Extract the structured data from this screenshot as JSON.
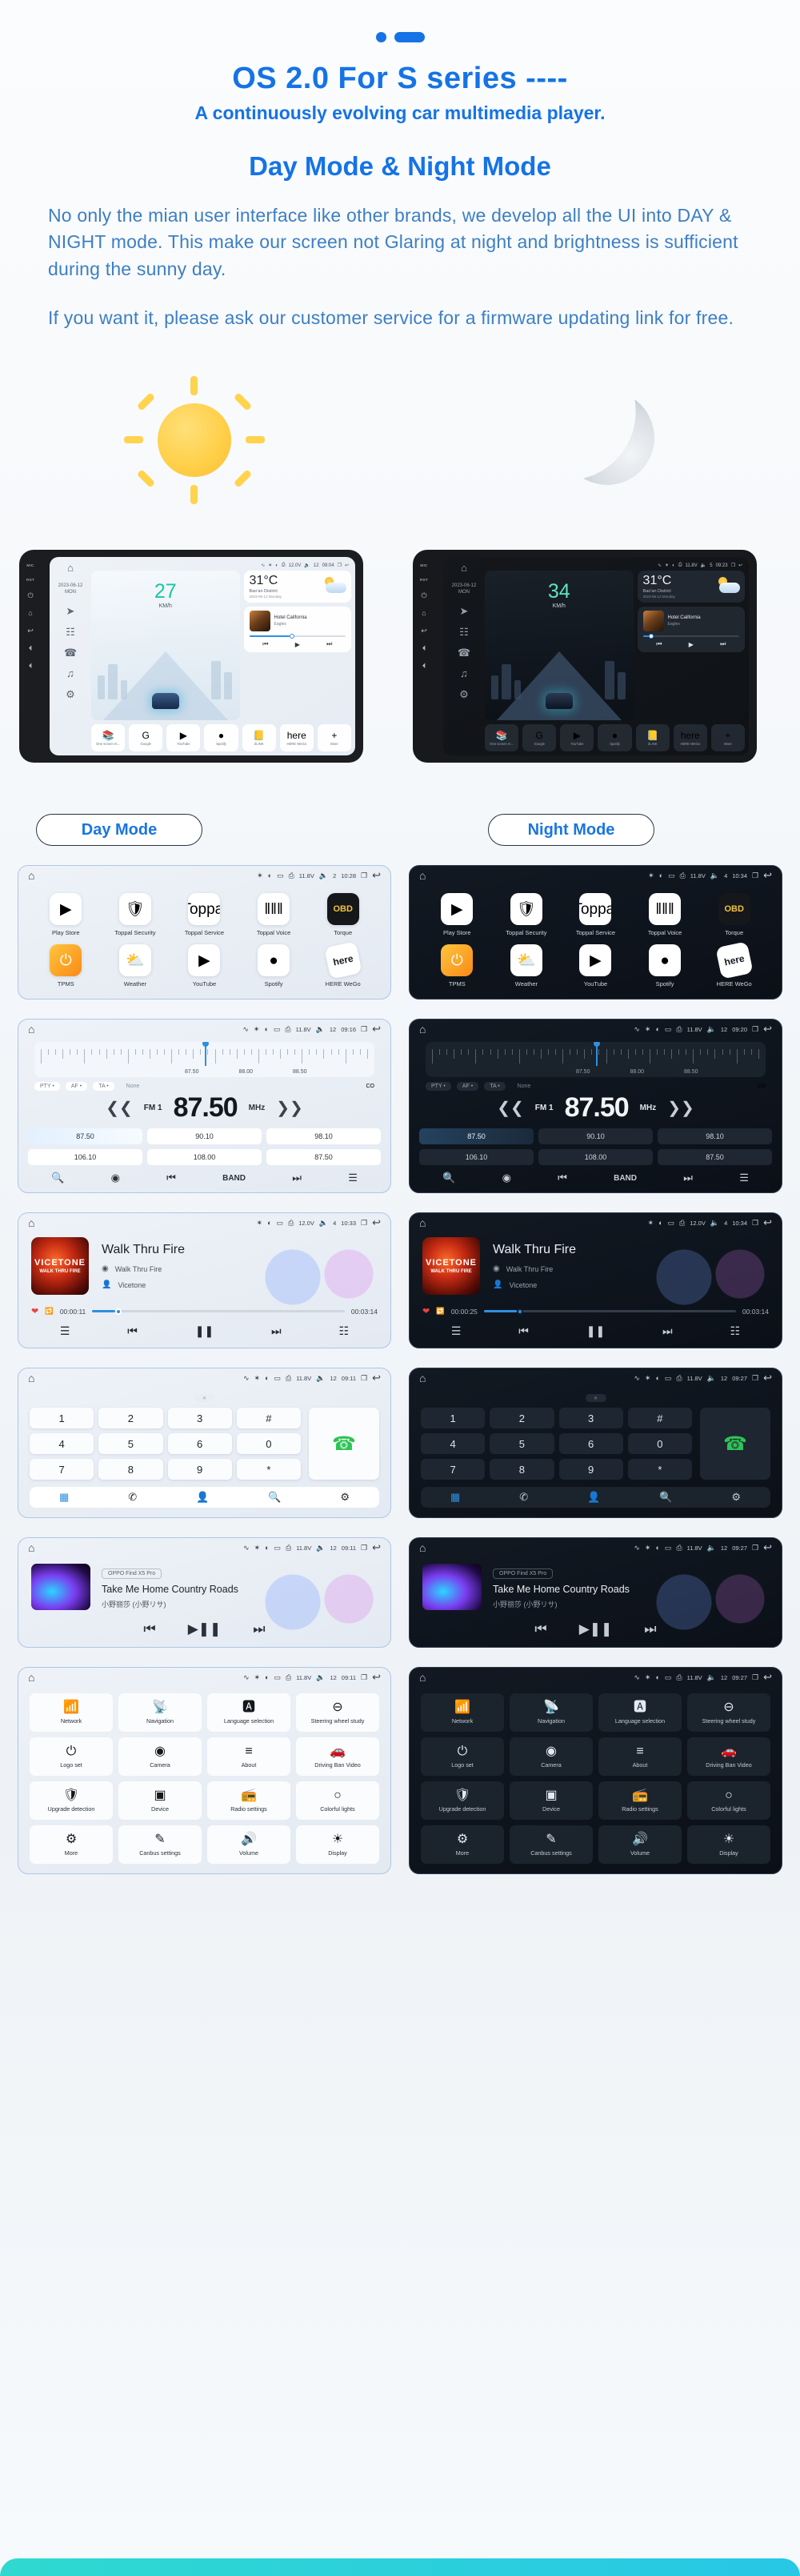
{
  "header": {
    "title": "OS 2.0 For S series ----",
    "subtitle": "A continuously evolving car multimedia player.",
    "section_title": "Day Mode & Night Mode",
    "paragraph1": "No only the mian user interface like other brands, we develop all the UI into DAY & NIGHT mode. This make our screen not Glaring at night and brightness is sufficient during the sunny day.",
    "paragraph2": "If you want it, please ask our customer service for a firmware updating link for free.",
    "accent_color": "#1573e6",
    "body_color": "#3d7fc4"
  },
  "badges": {
    "day": "Day Mode",
    "night": "Night Mode"
  },
  "head_units": {
    "day": {
      "date": "2023-06-12",
      "weekday": "MON",
      "speed": "27",
      "speed_unit": "KM/h",
      "status": {
        "voltage": "12.0V",
        "volume": "12",
        "time": "09:04"
      },
      "weather": {
        "temp": "31°C",
        "location": "Bao'an District",
        "date": "2023-06-12 Monday"
      },
      "now_playing": {
        "title": "Hotel California",
        "artist": "Eagles"
      },
      "dock": [
        {
          "name": "One screen m...",
          "glyph": "📚"
        },
        {
          "name": "Google",
          "glyph": "G"
        },
        {
          "name": "YouTube",
          "glyph": "▶"
        },
        {
          "name": "Spotify",
          "glyph": "●"
        },
        {
          "name": "ZLINK",
          "glyph": "📒"
        },
        {
          "name": "HERE WeGo",
          "glyph": "here"
        },
        {
          "name": "More",
          "glyph": "+"
        }
      ]
    },
    "night": {
      "date": "2023-06-12",
      "weekday": "MON",
      "speed": "34",
      "speed_unit": "KM/h",
      "status": {
        "voltage": "11.8V",
        "volume": "5",
        "time": "09:23"
      },
      "weather": {
        "temp": "31°C",
        "location": "Bao'an District",
        "date": "2023-06-12 Monday"
      },
      "now_playing": {
        "title": "Hotel California",
        "artist": "Eagles"
      },
      "dock": [
        {
          "name": "One screen m...",
          "glyph": "📚"
        },
        {
          "name": "Google",
          "glyph": "G"
        },
        {
          "name": "YouTube",
          "glyph": "▶"
        },
        {
          "name": "Spotify",
          "glyph": "●"
        },
        {
          "name": "ZLINK",
          "glyph": "📒"
        },
        {
          "name": "HERE WeGo",
          "glyph": "here"
        },
        {
          "name": "More",
          "glyph": "+"
        }
      ]
    }
  },
  "rows": {
    "apps": {
      "day_status": {
        "voltage": "11.8V",
        "volume": "2",
        "time": "10:28"
      },
      "night_status": {
        "voltage": "11.8V",
        "volume": "4",
        "time": "10:34"
      },
      "items": [
        {
          "label": "Play Store",
          "glyph": "▶"
        },
        {
          "label": "Toppal Security",
          "glyph": "🛡"
        },
        {
          "label": "Toppal Service",
          "glyph": "Toppal"
        },
        {
          "label": "Toppal Voice",
          "glyph": "‖‖‖"
        },
        {
          "label": "Torque",
          "glyph": "OBD"
        },
        {
          "label": "TPMS",
          "glyph": "⏻"
        },
        {
          "label": "Weather",
          "glyph": "⛅"
        },
        {
          "label": "YouTube",
          "glyph": "▶"
        },
        {
          "label": "Spotify",
          "glyph": "●"
        },
        {
          "label": "HERE WeGo",
          "glyph": "here"
        }
      ]
    },
    "radio": {
      "day_status": {
        "voltage": "11.8V",
        "volume": "12",
        "time": "09:16"
      },
      "night_status": {
        "voltage": "11.8V",
        "volume": "12",
        "time": "09:20"
      },
      "band": "FM 1",
      "frequency": "87.50",
      "unit": "MHz",
      "dial_labels": [
        "87.50",
        "88.00",
        "88.50"
      ],
      "rds": [
        "PTY",
        "AF",
        "TA"
      ],
      "rds_text": "None",
      "stereo": "CO",
      "presets": [
        "87.50",
        "90.10",
        "98.10",
        "106.10",
        "108.00",
        "87.50"
      ],
      "bottom": [
        "search-icon",
        "rds-icon",
        "prev-icon",
        "BAND",
        "next-icon",
        "eq-icon"
      ],
      "band_label": "BAND"
    },
    "music": {
      "day_status": {
        "voltage": "12.0V",
        "volume": "4",
        "time": "10:33"
      },
      "night_status": {
        "voltage": "12.0V",
        "volume": "4",
        "time": "10:34"
      },
      "title": "Walk Thru Fire",
      "song": "Walk Thru Fire",
      "artist": "Vicetone",
      "cover_line1": "VICETONE",
      "cover_line2": "WALK THRU FIRE",
      "time_current_day": "00:00:11",
      "time_current_night": "00:00:25",
      "time_total": "00:03:14"
    },
    "dialer": {
      "day_status": {
        "voltage": "11.8V",
        "volume": "12",
        "time": "09:11"
      },
      "night_status": {
        "voltage": "11.8V",
        "volume": "12",
        "time": "09:27"
      },
      "keys": [
        "1",
        "2",
        "3",
        "#",
        "4",
        "5",
        "6",
        "0",
        "7",
        "8",
        "9",
        "*"
      ],
      "call": "call-icon",
      "tabs": [
        "keypad-icon",
        "calllog-icon",
        "contacts-icon",
        "search-icon",
        "btsettings-icon"
      ]
    },
    "btmusic": {
      "day_status": {
        "voltage": "11.8V",
        "volume": "12",
        "time": "09:11"
      },
      "night_status": {
        "voltage": "11.8V",
        "volume": "12",
        "time": "09:27"
      },
      "device": "OPPO Find X5 Pro",
      "title": "Take Me Home Country Roads",
      "artist": "小野丽莎 (小野リサ)"
    },
    "settings": {
      "day_status": {
        "voltage": "11.8V",
        "volume": "12",
        "time": "09:11"
      },
      "night_status": {
        "voltage": "11.8V",
        "volume": "12",
        "time": "09:27"
      },
      "items": [
        {
          "label": "Network",
          "glyph": "📶"
        },
        {
          "label": "Navigation",
          "glyph": "📡"
        },
        {
          "label": "Language selection",
          "glyph": "🅰"
        },
        {
          "label": "Steering wheel study",
          "glyph": "⊖"
        },
        {
          "label": "Logo set",
          "glyph": "⏻"
        },
        {
          "label": "Camera",
          "glyph": "◉"
        },
        {
          "label": "About",
          "glyph": "≡"
        },
        {
          "label": "Driving Ban Video",
          "glyph": "🚗"
        },
        {
          "label": "Upgrade detection",
          "glyph": "🛡"
        },
        {
          "label": "Device",
          "glyph": "▣"
        },
        {
          "label": "Radio settings",
          "glyph": "📻"
        },
        {
          "label": "Colorful lights",
          "glyph": "○"
        },
        {
          "label": "More",
          "glyph": "⚙"
        },
        {
          "label": "Canbus settings",
          "glyph": "✎"
        },
        {
          "label": "Volume",
          "glyph": "🔊"
        },
        {
          "label": "Display",
          "glyph": "☀"
        }
      ]
    }
  },
  "status_icons": {
    "usb": "∿",
    "bt": "✶",
    "wifi": "◠",
    "signal": "▭",
    "lock": "⎙",
    "battery": "⎓",
    "volume": "◁",
    "recent": "❐",
    "back": "↩",
    "home": "⌂"
  }
}
